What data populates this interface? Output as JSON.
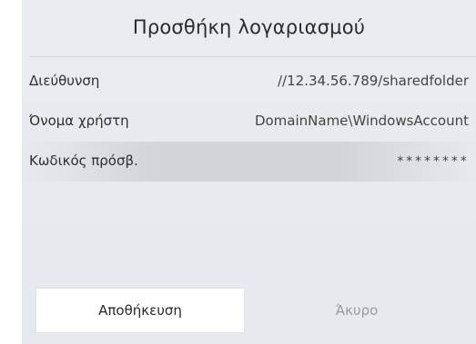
{
  "dialog": {
    "title": "Προσθήκη λογαριασμού",
    "fields": [
      {
        "label": "Διεύθυνση",
        "value": "//12.34.56.789/sharedfolder"
      },
      {
        "label": "Όνομα χρήστη",
        "value": "DomainName\\WindowsAccount"
      },
      {
        "label": "Κωδικός πρόσβ.",
        "value": "********"
      }
    ],
    "buttons": {
      "save_label": "Αποθήκευση",
      "cancel_label": "Άκυρο"
    }
  },
  "colors": {
    "dialog_background": "#e8ebf0",
    "focused_row": "#d0d3d8",
    "primary_text": "#2b2b2b",
    "disabled_text": "#9a9ca1",
    "save_button_background": "#ffffff"
  }
}
